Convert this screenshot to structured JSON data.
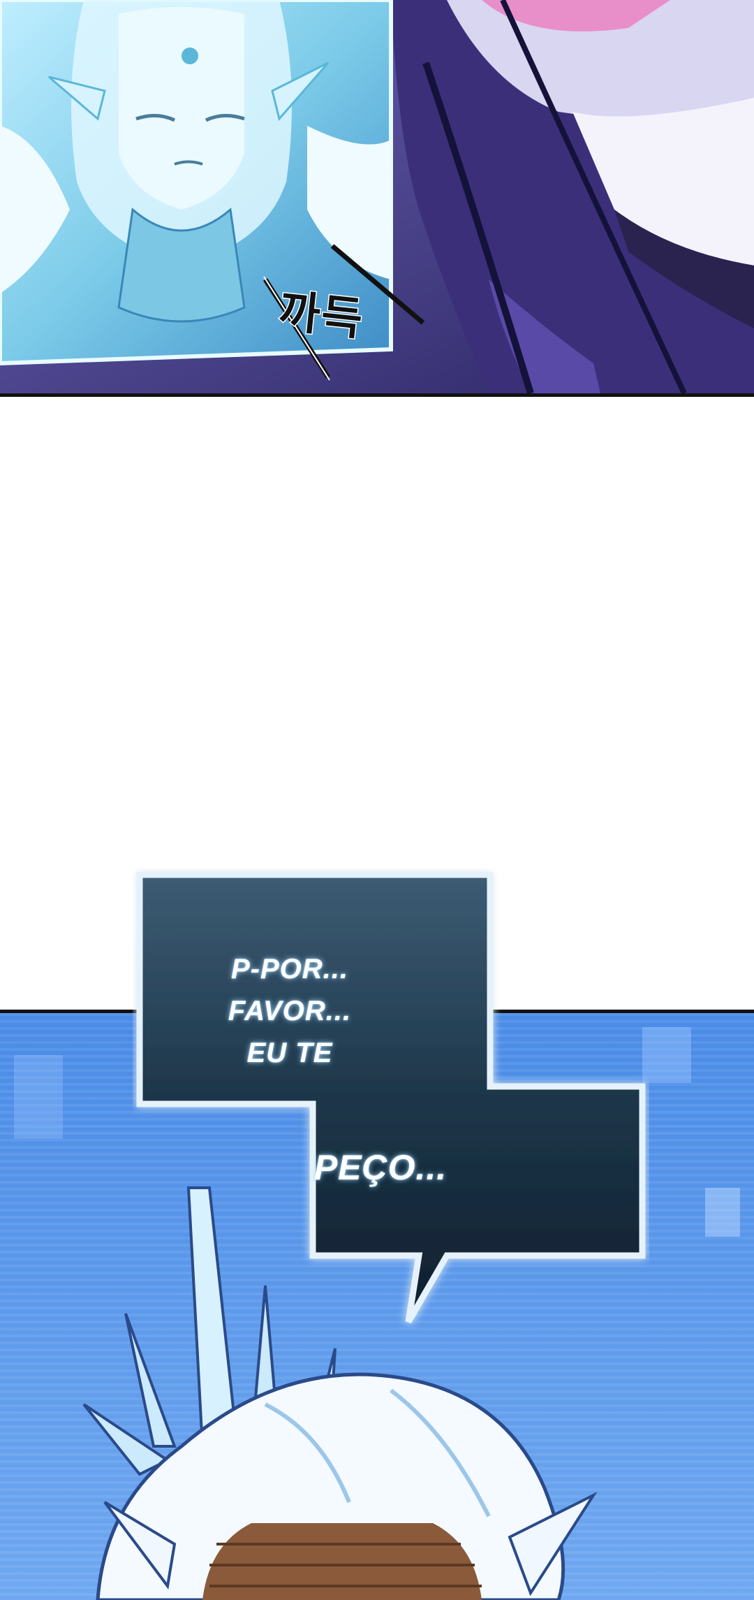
{
  "panel_top": {
    "sfx_text": "까득"
  },
  "speech_bubble": {
    "line1": "P-POR... FAVOR...",
    "line2": "EU TE",
    "line3": "PEÇO..."
  },
  "colors": {
    "bubble_fill": "#1d3649",
    "bubble_border": "#e6f2fb",
    "ice_blue": "#8fd3ee",
    "bottom_bg": "#4a83e0",
    "night_purple": "#4a3d8f"
  }
}
